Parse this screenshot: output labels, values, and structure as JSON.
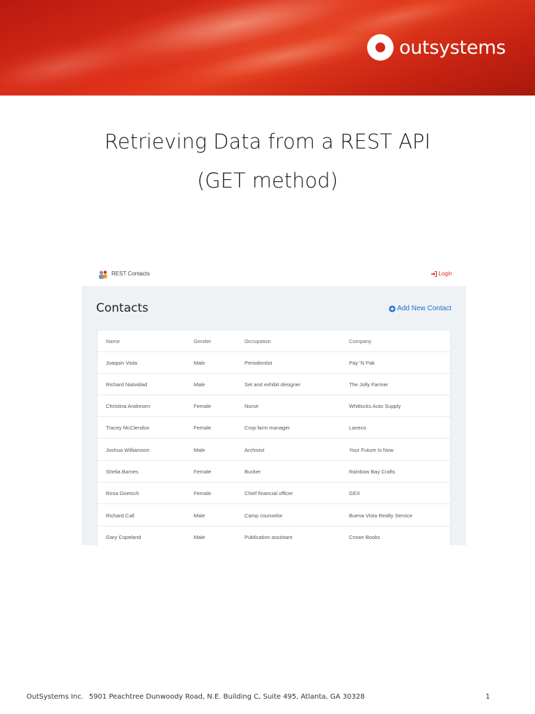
{
  "header": {
    "logo_text": "outsystems",
    "brand_color": "#d4281a"
  },
  "document": {
    "title_line1": "Retrieving Data from a REST API",
    "title_line2": "(GET method)"
  },
  "app": {
    "name": "REST Contacts",
    "login_label": "Login",
    "page_title": "Contacts",
    "add_button_label": "Add New Contact",
    "accent_color": "#1d6cc8",
    "columns": [
      "Name",
      "Gender",
      "Occupation",
      "Company"
    ],
    "rows": [
      [
        "Joaquin Viola",
        "Male",
        "Periodontist",
        "Pay 'N Pak"
      ],
      [
        "Richard Natividad",
        "Male",
        "Set and exhibit designer",
        "The Jolly Farmer"
      ],
      [
        "Christina Andresen",
        "Female",
        "Nurse",
        "Whitlocks Auto Supply"
      ],
      [
        "Tracey McClendon",
        "Female",
        "Crop farm manager",
        "Laneco"
      ],
      [
        "Joshua Williamson",
        "Male",
        "Archivist",
        "Your Future Is Now"
      ],
      [
        "Shelia Barnes",
        "Female",
        "Bucker",
        "Rainbow Bay Crafts"
      ],
      [
        "Rosa Goetsch",
        "Female",
        "Chief financial officer",
        "GEX"
      ],
      [
        "Richard Call",
        "Male",
        "Camp counselor",
        "Buena Vista Realty Service"
      ],
      [
        "Gary Copeland",
        "Male",
        "Publication assistant",
        "Crown Books"
      ]
    ]
  },
  "footer": {
    "company": "OutSystems Inc.",
    "address": "5901 Peachtree Dunwoody Road, N.E. Building C, Suite 495, Atlanta, GA 30328",
    "page_number": "1"
  }
}
